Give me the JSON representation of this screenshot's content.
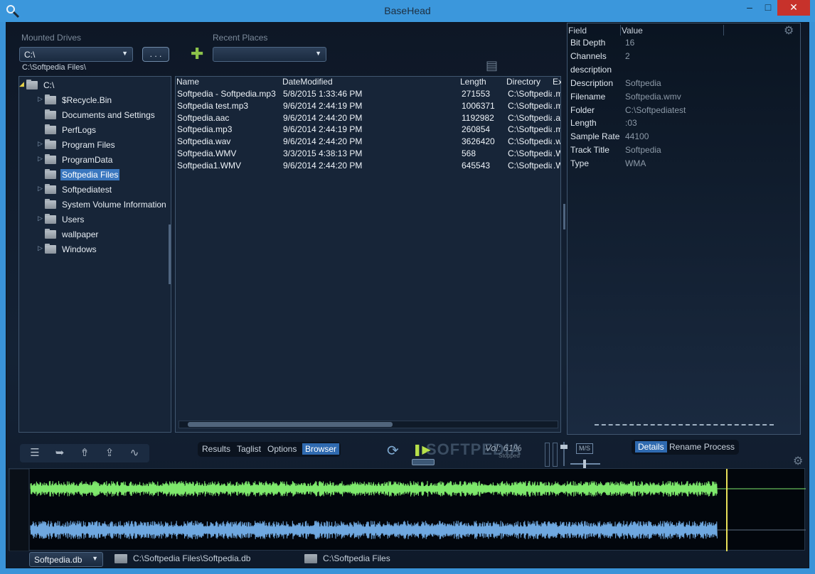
{
  "window": {
    "title": "BaseHead"
  },
  "left": {
    "mounted_drives_label": "Mounted Drives",
    "drive_value": "C:\\",
    "browse_label": ". . .",
    "current_path": "C:\\Softpedia Files\\",
    "recent_places_label": "Recent Places",
    "recent_value": ""
  },
  "tree": {
    "root": "C:\\",
    "items": [
      {
        "label": "$Recycle.Bin",
        "expandable": true
      },
      {
        "label": "Documents and Settings",
        "expandable": false
      },
      {
        "label": "PerfLogs",
        "expandable": false
      },
      {
        "label": "Program Files",
        "expandable": true
      },
      {
        "label": "ProgramData",
        "expandable": true
      },
      {
        "label": "Softpedia Files",
        "expandable": false,
        "selected": true
      },
      {
        "label": "Softpediatest",
        "expandable": true
      },
      {
        "label": "System Volume Information",
        "expandable": false
      },
      {
        "label": "Users",
        "expandable": true
      },
      {
        "label": "wallpaper",
        "expandable": false
      },
      {
        "label": "Windows",
        "expandable": true
      }
    ]
  },
  "files": {
    "columns": [
      "Name",
      "DateModified",
      "Length",
      "Directory",
      "Ex"
    ],
    "rows": [
      {
        "name": "Softpedia - Softpedia.mp3",
        "date": "5/8/2015 1:33:46 PM",
        "length": "271553",
        "dir": "C:\\Softpedia",
        "ext": ".m"
      },
      {
        "name": "Softpedia test.mp3",
        "date": "9/6/2014 2:44:19 PM",
        "length": "1006371",
        "dir": "C:\\Softpedia",
        "ext": ".m"
      },
      {
        "name": "Softpedia.aac",
        "date": "9/6/2014 2:44:20 PM",
        "length": "1192982",
        "dir": "C:\\Softpedia",
        "ext": ".a"
      },
      {
        "name": "Softpedia.mp3",
        "date": "9/6/2014 2:44:19 PM",
        "length": "260854",
        "dir": "C:\\Softpedia",
        "ext": ".m"
      },
      {
        "name": "Softpedia.wav",
        "date": "9/6/2014 2:44:20 PM",
        "length": "3626420",
        "dir": "C:\\Softpedia",
        "ext": ".w"
      },
      {
        "name": "Softpedia.WMV",
        "date": "3/3/2015 4:38:13 PM",
        "length": "568",
        "dir": "C:\\Softpedia",
        "ext": ".W"
      },
      {
        "name": "Softpedia1.WMV",
        "date": "9/6/2014 2:44:20 PM",
        "length": "645543",
        "dir": "C:\\Softpedia",
        "ext": ".W"
      }
    ]
  },
  "details": {
    "col_field": "Field",
    "col_value": "Value",
    "rows": [
      {
        "field": "Bit Depth",
        "value": "16"
      },
      {
        "field": "Channels",
        "value": "2"
      },
      {
        "field": "description",
        "value": ""
      },
      {
        "field": "Description",
        "value": "Softpedia"
      },
      {
        "field": "Filename",
        "value": "Softpedia.wmv"
      },
      {
        "field": "Folder",
        "value": "C:\\Softpediatest"
      },
      {
        "field": "Length",
        "value": ":03"
      },
      {
        "field": "Sample Rate",
        "value": "44100"
      },
      {
        "field": "Track Title",
        "value": "Softpedia"
      },
      {
        "field": "Type",
        "value": "WMA"
      }
    ]
  },
  "tabs_left": [
    "Results",
    "Taglist",
    "Options",
    "Browser"
  ],
  "tabs_left_active": "Browser",
  "tabs_right": [
    "Details",
    "Rename Process"
  ],
  "tabs_right_active": "Details",
  "transport": {
    "volume": "Vol: 61%",
    "status": "Stopped",
    "ms_label": "M/S",
    "watermark": "SOFTPEDIA"
  },
  "bottom": {
    "database": "Softpedia.db",
    "db_path": "C:\\Softpedia Files\\Softpedia.db",
    "folder_path": "C:\\Softpedia Files"
  },
  "colors": {
    "wave_top": "#7ee86c",
    "wave_bottom": "#6fa8e0",
    "playhead": "#e9e05a",
    "accent": "#2f6ab0"
  }
}
